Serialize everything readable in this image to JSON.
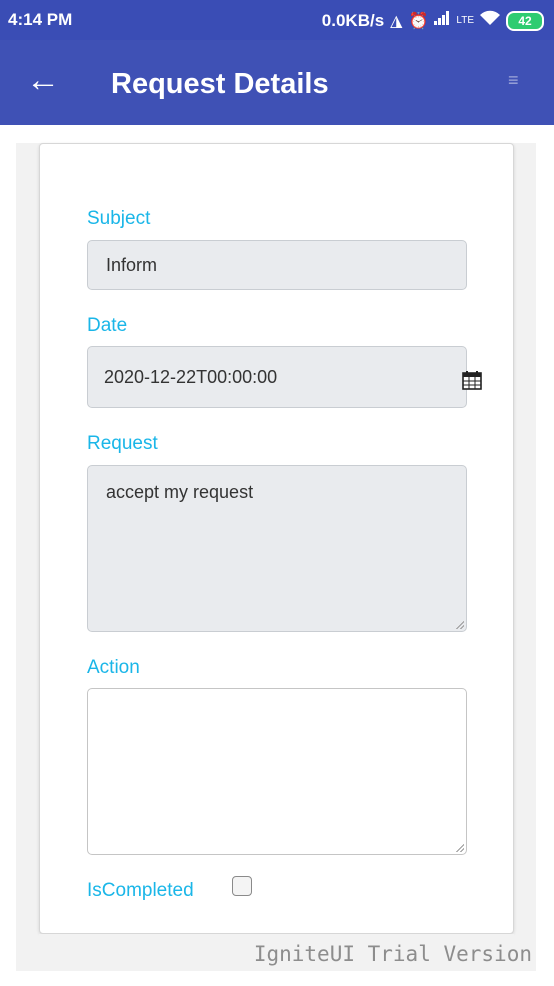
{
  "status_bar": {
    "time": "4:14 PM",
    "net_speed": "0.0KB/s",
    "icons": [
      "headphones-icon",
      "alarm-off-icon",
      "signal-icon",
      "volte-icon",
      "wifi-icon"
    ],
    "battery": "42"
  },
  "app_bar": {
    "back_icon": "arrow-left-icon",
    "title": "Request Details",
    "menu_icon": "menu-icon",
    "color": "#3f51b5"
  },
  "form": {
    "subject": {
      "label": "Subject",
      "value": "Inform"
    },
    "date": {
      "label": "Date",
      "value": "2020-12-22T00:00:00",
      "icon": "calendar-icon"
    },
    "request": {
      "label": "Request",
      "value": "accept my request"
    },
    "action": {
      "label": "Action",
      "value": ""
    },
    "is_completed": {
      "label": "IsCompleted",
      "checked": false
    }
  },
  "accent_color": "#1ab6e8",
  "watermark": "IgniteUI Trial Version"
}
